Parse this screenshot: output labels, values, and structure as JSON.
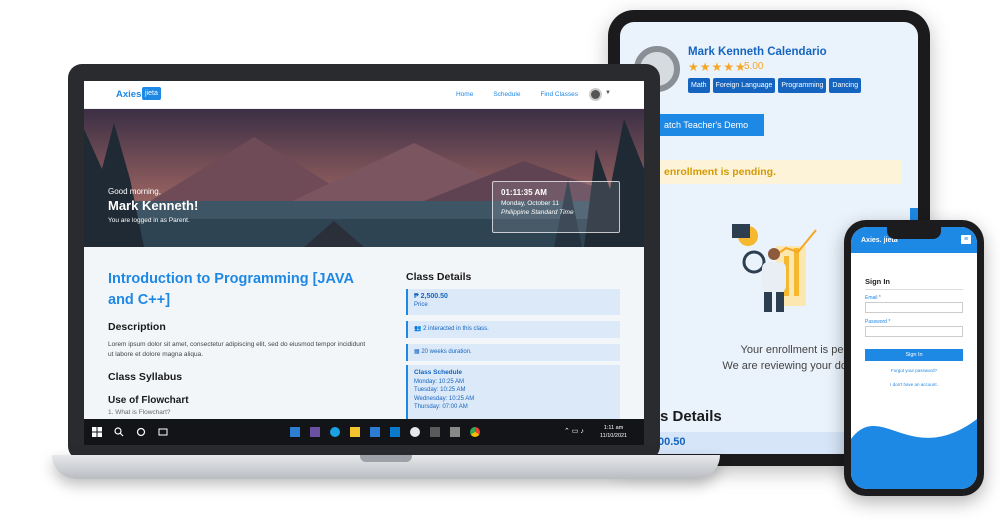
{
  "tablet": {
    "teacher_name": "Mark Kenneth Calendario",
    "stars": "★★★★★",
    "rating": "5.00",
    "tags": [
      "Math",
      "Foreign Language",
      "Programming",
      "Dancing"
    ],
    "demo_button": "atch Teacher's Demo",
    "pending_banner": "enrollment is pending.",
    "message_line1": "Your enrollment is pending.",
    "message_line2": "We are reviewing your documents.",
    "details_heading": "s Details",
    "price": "00.50"
  },
  "laptop": {
    "nav": {
      "logo": "Axies.",
      "logo_badge": "jieta",
      "links": [
        "Home",
        "Schedule",
        "Find Classes"
      ]
    },
    "hero": {
      "greeting": "Good morning,",
      "name": "Mark Kenneth!",
      "subtitle": "You are logged in as Parent.",
      "time": "01:11:35 AM",
      "date": "Monday, October 11",
      "timezone": "Philippine Standard Time"
    },
    "course": {
      "title": "Introduction to Programming [JAVA and C++]",
      "description_heading": "Description",
      "description": "Lorem ipsum dolor sit amet, consectetur adipiscing elit, sed do eiusmod tempor incididunt ut labore et dolore magna aliqua.",
      "syllabus_heading": "Class Syllabus",
      "syllabus_item": "Use of Flowchart",
      "syllabus_sub": "1. What is Flowchart?"
    },
    "details": {
      "heading": "Class Details",
      "price": "₱ 2,500.50",
      "price_label": "Price",
      "interacted": "2 interacted in this class.",
      "duration": "20 weeks duration.",
      "schedule_heading": "Class Schedule",
      "schedule": [
        "Monday: 10:25 AM",
        "Tuesday: 10:25 AM",
        "Wednesday: 10:25 AM",
        "Thursday: 07:00 AM"
      ]
    },
    "taskbar": {
      "time": "1:11 am",
      "date": "11/10/2021"
    }
  },
  "phone": {
    "logo": "Axies.",
    "logo_badge": "jieta",
    "signin_heading": "Sign In",
    "email_label": "Email *",
    "password_label": "Password *",
    "signin_button": "Sign In",
    "forgot": "Forgot your password?",
    "no_account": "I don't have an account."
  },
  "colors": {
    "brand_blue": "#1e88e5",
    "star": "#f5a623",
    "pending": "#d69a00"
  }
}
